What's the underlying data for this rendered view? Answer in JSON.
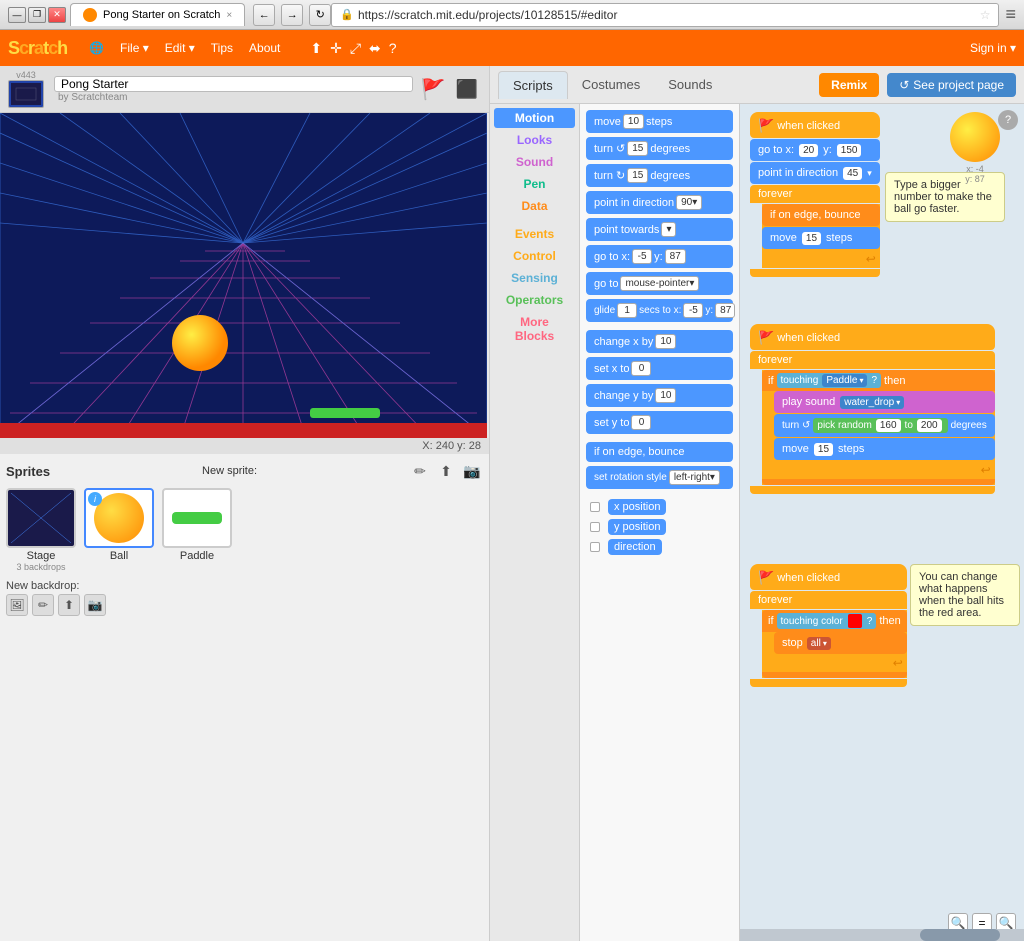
{
  "browser": {
    "title": "Pong Starter on Scratch",
    "tab_close": "×",
    "url": "https://scratch.mit.edu/projects/10128515/#editor",
    "back_btn": "←",
    "forward_btn": "→",
    "refresh_btn": "↻",
    "star": "☆",
    "menu": "≡",
    "win_minimize": "—",
    "win_restore": "❐",
    "win_close": "✕"
  },
  "scratch": {
    "logo": "Scratch",
    "nav": {
      "file": "File",
      "edit": "Edit",
      "tips": "Tips",
      "about": "About"
    },
    "nav_icons": [
      "🌐",
      "↑",
      "⤢",
      "⬌",
      "?"
    ],
    "signin": "Sign in ▾",
    "project_name": "Pong Starter",
    "project_author": "by Scratchteam",
    "version": "v443"
  },
  "tabs": {
    "scripts": "Scripts",
    "costumes": "Costumes",
    "sounds": "Sounds",
    "remix": "Remix",
    "see_project": "See project page"
  },
  "categories": [
    "Motion",
    "Looks",
    "Sound",
    "Pen",
    "Data",
    "Events",
    "Control",
    "Sensing",
    "Operators",
    "More Blocks"
  ],
  "blocks": [
    "move 10 steps",
    "turn ↺ 15 degrees",
    "turn ↻ 15 degrees",
    "point in direction 90▾",
    "point towards ▾",
    "go to x: -5 y: 87",
    "go to mouse-pointer ▾",
    "glide 1 secs to x: -5 y: 87",
    "change x by 10",
    "set x to 0",
    "change y by 10",
    "set y to 0",
    "if on edge, bounce",
    "set rotation style left-right ▾",
    "x position",
    "y position",
    "direction"
  ],
  "sprites": {
    "title": "Sprites",
    "new_sprite": "New sprite:",
    "stage_label": "Stage",
    "stage_sub": "3 backdrops",
    "ball_label": "Ball",
    "paddle_label": "Paddle",
    "new_backdrop": "New backdrop:",
    "info_icon": "i"
  },
  "stage": {
    "coords": "X: 240  y: 28"
  },
  "workspace": {
    "stack1": {
      "hat": "when 🚩 clicked",
      "blocks": [
        "go to x: 20 y: 150",
        "point in direction 45▾",
        "forever",
        "if on edge, bounce",
        "move 15 steps"
      ],
      "tooltip": "Type a bigger number to make the ball go faster."
    },
    "stack2": {
      "hat": "when 🚩 clicked",
      "blocks": [
        "forever",
        "if touching Paddle ▾ ? then",
        "play sound water_drop ▾",
        "turn ↺ pick random 160 to 200 degrees",
        "move 15 steps"
      ]
    },
    "stack3": {
      "hat": "when 🚩 clicked",
      "blocks": [
        "forever",
        "if touching color 🟥 ? then",
        "stop all ▾"
      ],
      "tooltip": "You can change what happens when the ball hits the red area."
    }
  },
  "zoom": {
    "out": "🔍-",
    "eq": "=",
    "in": "🔍+"
  }
}
